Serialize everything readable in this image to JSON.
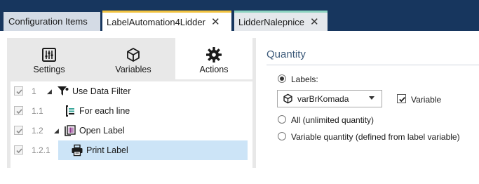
{
  "tabs": {
    "config": {
      "label": "Configuration Items"
    },
    "label_automation": {
      "label": "LabelAutomation4Lidder",
      "close": "✕",
      "accent": "#f1c23f"
    },
    "lidder": {
      "label": "LidderNalepnice",
      "close": "✕",
      "accent": "#8cd3c0"
    }
  },
  "toolbar": {
    "settings": {
      "label": "Settings",
      "icon": "sliders-icon"
    },
    "variables": {
      "label": "Variables",
      "icon": "cube-icon"
    },
    "actions": {
      "label": "Actions",
      "icon": "gear-icon"
    }
  },
  "tree": [
    {
      "num": "1",
      "label": "Use Data Filter",
      "icon": "filter-icon",
      "checked": true
    },
    {
      "num": "1.1",
      "label": "For each line",
      "icon": "loop-icon",
      "checked": true
    },
    {
      "num": "1.2",
      "label": "Open Label",
      "icon": "open-label-icon",
      "checked": true
    },
    {
      "num": "1.2.1",
      "label": "Print Label",
      "icon": "printer-icon",
      "checked": true,
      "selected": true
    }
  ],
  "quantity": {
    "title": "Quantity",
    "labels_option": "Labels:",
    "dropdown_value": "varBrKomada",
    "variable_label": "Variable",
    "variable_checked": true,
    "all_option": "All (unlimited quantity)",
    "variable_quantity_option": "Variable quantity (defined from label variable)",
    "selected_option": "labels"
  },
  "colors": {
    "titlebar": "#17365e",
    "selection": "#cce4f7",
    "section_title": "#3c5a7a"
  }
}
